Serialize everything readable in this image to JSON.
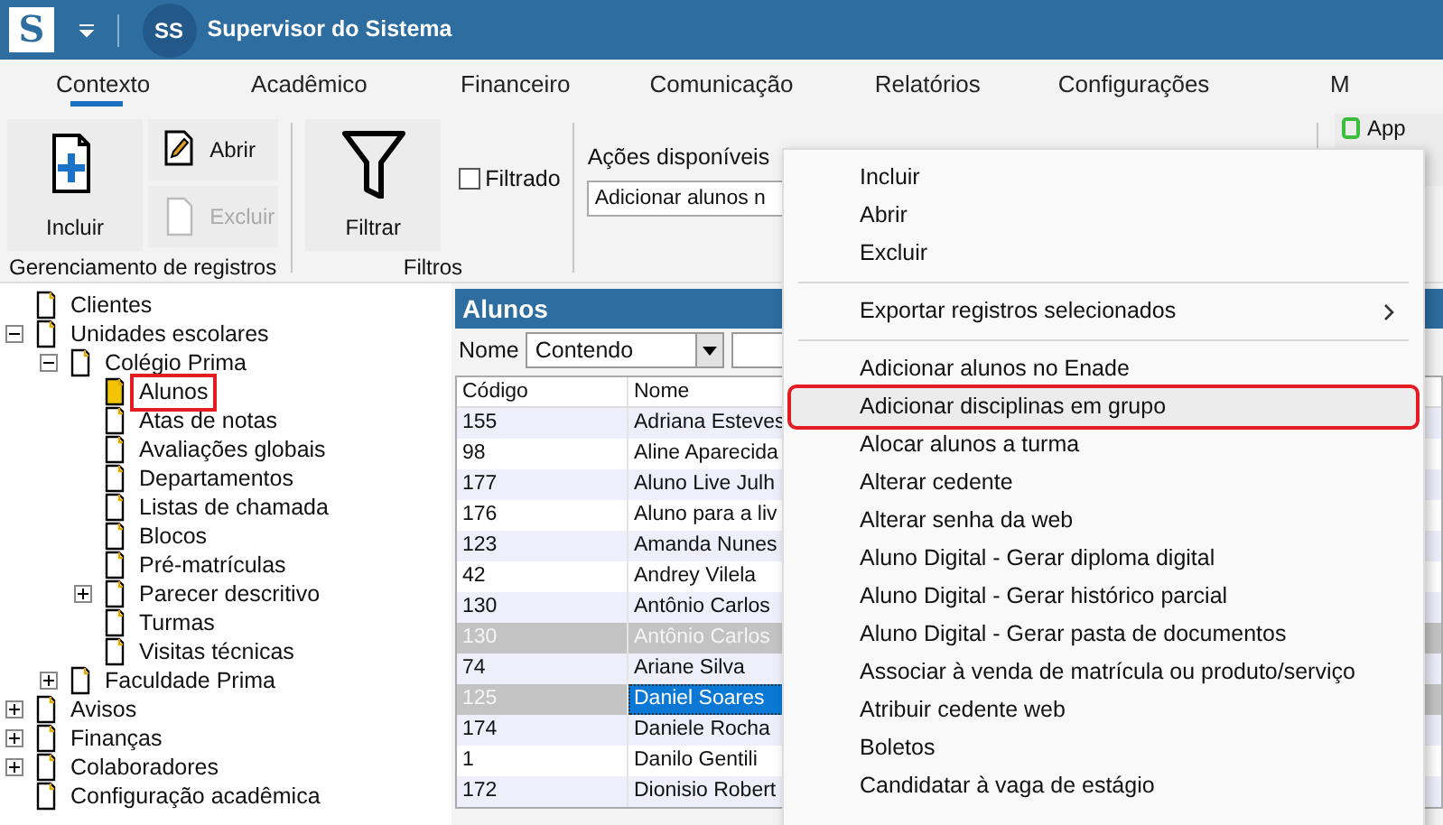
{
  "title_bar": {
    "logo": "S",
    "avatar": "SS",
    "user": "Supervisor do Sistema"
  },
  "tabs": [
    {
      "label": "Contexto",
      "selected": true
    },
    {
      "label": "Acadêmico",
      "selected": false
    },
    {
      "label": "Financeiro",
      "selected": false
    },
    {
      "label": "Comunicação",
      "selected": false
    },
    {
      "label": "Relatórios",
      "selected": false
    },
    {
      "label": "Configurações",
      "selected": false
    },
    {
      "label": "M",
      "selected": false
    }
  ],
  "ribbon": {
    "groups": [
      {
        "label": "Gerenciamento de registros",
        "buttons": [
          {
            "label": "Incluir",
            "kind": "add",
            "disabled": false
          },
          {
            "label": "Abrir",
            "kind": "open",
            "disabled": false
          },
          {
            "label": "Excluir",
            "kind": "delete",
            "disabled": true
          }
        ]
      },
      {
        "label": "Filtros",
        "buttons": [
          {
            "label": "Filtrar",
            "kind": "filter",
            "disabled": false
          }
        ],
        "checkbox": {
          "label": "Filtrado",
          "checked": false
        }
      },
      {
        "actions_label": "Ações disponíveis",
        "actions_value": "Adicionar alunos n"
      }
    ],
    "app_button": "App"
  },
  "tree": [
    {
      "label": "Clientes",
      "selected": false
    },
    {
      "label": "Unidades escolares",
      "selected": false,
      "expanded": true,
      "children": [
        {
          "label": "Colégio Prima",
          "selected": false,
          "expanded": true,
          "children": [
            {
              "label": "Alunos",
              "selected": true,
              "highlighted": true
            },
            {
              "label": "Atas de notas",
              "selected": false
            },
            {
              "label": "Avaliações globais",
              "selected": false
            },
            {
              "label": "Departamentos",
              "selected": false
            },
            {
              "label": "Listas de chamada",
              "selected": false
            },
            {
              "label": "Blocos",
              "selected": false
            },
            {
              "label": "Pré-matrículas",
              "selected": false
            },
            {
              "label": "Parecer descritivo",
              "selected": false,
              "expanded": false
            },
            {
              "label": "Turmas",
              "selected": false
            },
            {
              "label": "Visitas técnicas",
              "selected": false
            }
          ]
        },
        {
          "label": "Faculdade Prima",
          "selected": false,
          "expanded": false
        }
      ]
    },
    {
      "label": "Avisos",
      "selected": false,
      "expanded": false
    },
    {
      "label": "Finanças",
      "selected": false,
      "expanded": false
    },
    {
      "label": "Colaboradores",
      "selected": false,
      "expanded": false
    },
    {
      "label": "Configuração acadêmica",
      "selected": false
    }
  ],
  "grid": {
    "title": "Alunos",
    "filter": {
      "field": "Nome",
      "operator": "Contendo"
    },
    "columns": [
      "Código",
      "Nome"
    ],
    "rows": [
      {
        "cells": [
          "155",
          "Adriana Esteves"
        ],
        "inactive": false,
        "selected": false
      },
      {
        "cells": [
          "98",
          "Aline Aparecida"
        ],
        "inactive": false,
        "selected": false
      },
      {
        "cells": [
          "177",
          "Aluno Live Julh"
        ],
        "inactive": false,
        "selected": false
      },
      {
        "cells": [
          "176",
          "Aluno para a liv"
        ],
        "inactive": false,
        "selected": false
      },
      {
        "cells": [
          "123",
          "Amanda Nunes"
        ],
        "inactive": false,
        "selected": false
      },
      {
        "cells": [
          "42",
          "Andrey Vilela"
        ],
        "inactive": false,
        "selected": false
      },
      {
        "cells": [
          "130",
          "Antônio Carlos"
        ],
        "inactive": false,
        "selected": false
      },
      {
        "cells": [
          "130",
          "Antônio Carlos"
        ],
        "inactive": true,
        "selected": false
      },
      {
        "cells": [
          "74",
          "Ariane Silva"
        ],
        "inactive": false,
        "selected": false
      },
      {
        "cells": [
          "125",
          "Daniel Soares"
        ],
        "inactive": true,
        "selected": true
      },
      {
        "cells": [
          "174",
          "Daniele Rocha"
        ],
        "inactive": false,
        "selected": false
      },
      {
        "cells": [
          "1",
          "Danilo Gentili"
        ],
        "inactive": false,
        "selected": false
      },
      {
        "cells": [
          "172",
          "Dionisio Robert"
        ],
        "inactive": false,
        "selected": false
      }
    ]
  },
  "context_menu": {
    "groups": [
      [
        {
          "label": "Incluir",
          "highlighted": false
        },
        {
          "label": "Abrir",
          "highlighted": false
        },
        {
          "label": "Excluir",
          "highlighted": false
        }
      ],
      [
        {
          "label": "Exportar registros selecionados",
          "highlighted": false,
          "submenu": true
        }
      ],
      [
        {
          "label": "Adicionar alunos no Enade",
          "highlighted": false
        },
        {
          "label": "Adicionar disciplinas em grupo",
          "highlighted": true
        },
        {
          "label": "Alocar alunos a turma",
          "highlighted": false
        },
        {
          "label": "Alterar cedente",
          "highlighted": false
        },
        {
          "label": "Alterar senha da web",
          "highlighted": false
        },
        {
          "label": "Aluno Digital - Gerar diploma digital",
          "highlighted": false
        },
        {
          "label": "Aluno Digital - Gerar histórico parcial",
          "highlighted": false
        },
        {
          "label": "Aluno Digital - Gerar pasta de documentos",
          "highlighted": false
        },
        {
          "label": "Associar à venda de matrícula ou produto/serviço",
          "highlighted": false
        },
        {
          "label": "Atribuir cedente web",
          "highlighted": false
        },
        {
          "label": "Boletos",
          "highlighted": false
        },
        {
          "label": "Candidatar à vaga de estágio",
          "highlighted": false
        }
      ]
    ]
  }
}
